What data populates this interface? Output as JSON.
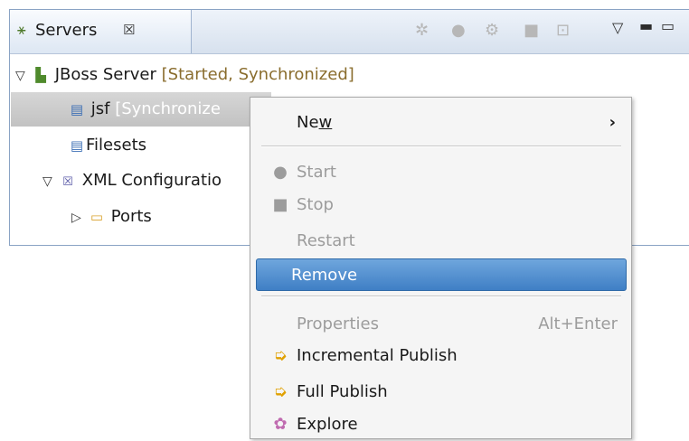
{
  "view": {
    "tab_title": "Servers",
    "tab_close": "☒",
    "tab_icon": "⚹"
  },
  "toolbar": {
    "debug_icon": "✲",
    "start_icon": "●",
    "profile_icon": "⚙",
    "stop_icon": "■",
    "publish_icon": "⊡",
    "menu_icon": "▽",
    "minimize_icon": "▬",
    "maximize_icon": "▭"
  },
  "tree": {
    "server": {
      "name": "JBoss Server",
      "decoration": "[Started, Synchronized]"
    },
    "module": {
      "name": "jsf",
      "decoration": "[Synchronize"
    },
    "filesets": {
      "name": "Filesets"
    },
    "xml_config": {
      "name": "XML Configuratio"
    },
    "ports": {
      "name": "Ports"
    }
  },
  "context_menu": {
    "items": [
      {
        "label": "New",
        "underline_index": 2,
        "enabled": true,
        "submenu": true
      },
      {
        "label": "Start",
        "enabled": false
      },
      {
        "label": "Stop",
        "enabled": false
      },
      {
        "label": "Restart",
        "enabled": false
      },
      {
        "label": "Remove",
        "enabled": true,
        "highlighted": true
      },
      {
        "label": "Properties",
        "shortcut": "Alt+Enter",
        "enabled": false
      },
      {
        "label": "Incremental Publish",
        "enabled": true
      },
      {
        "label": "Full Publish",
        "enabled": true
      },
      {
        "label": "Explore",
        "enabled": true
      }
    ]
  },
  "colors": {
    "decoration": "#8a6d2e",
    "highlight": "#4a8ad0",
    "disabled": "#9c9c9c"
  }
}
